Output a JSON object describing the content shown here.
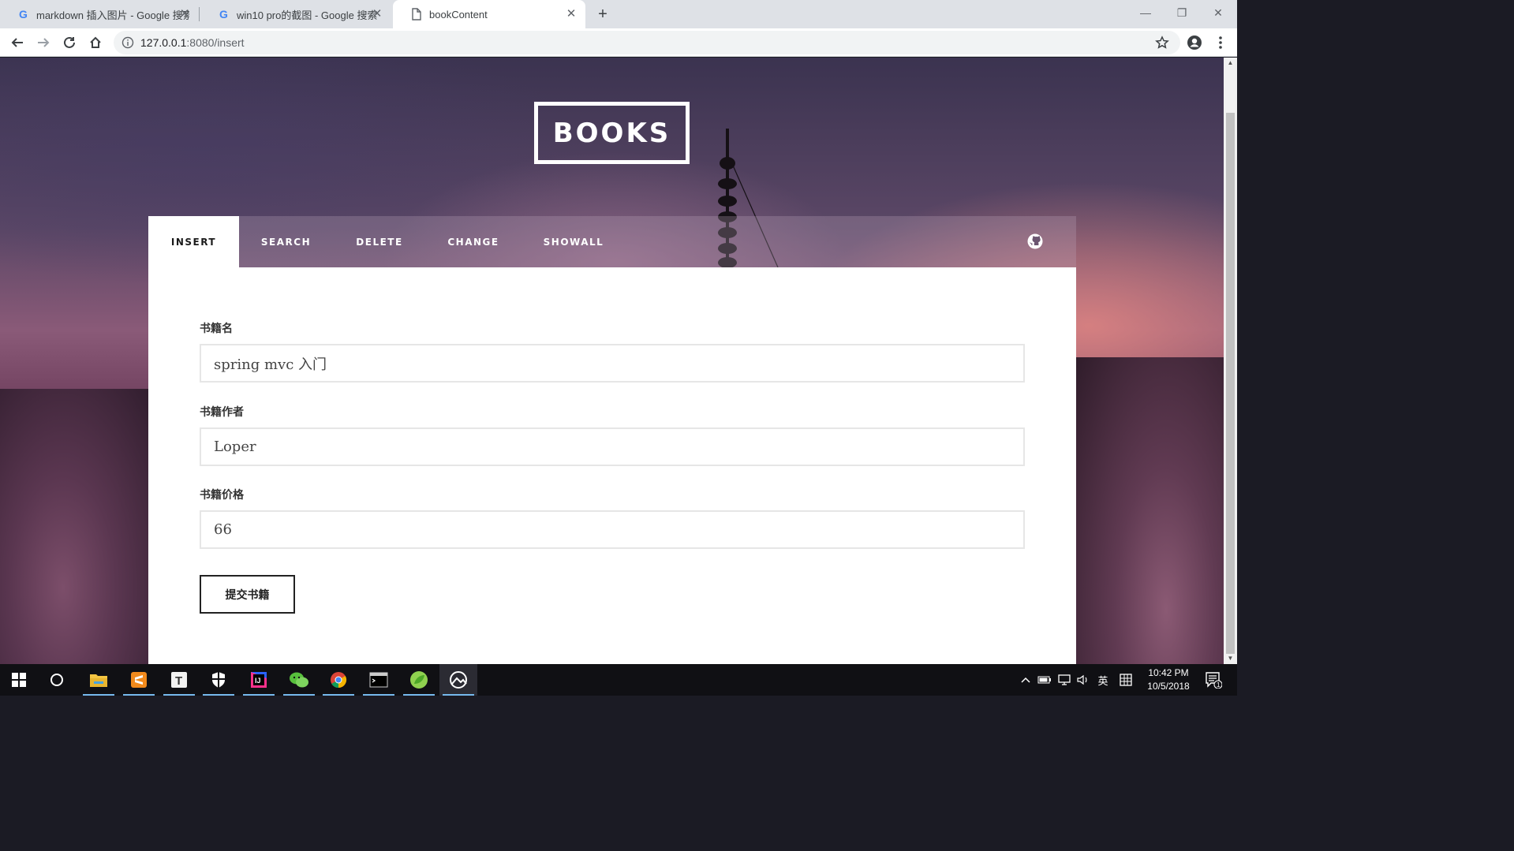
{
  "browser": {
    "tabs": [
      {
        "title": "markdown 插入图片 - Google 搜索",
        "favicon": "google-icon"
      },
      {
        "title": "win10 pro的截图 - Google 搜索",
        "favicon": "google-icon"
      },
      {
        "title": "bookContent",
        "favicon": "document-icon"
      }
    ],
    "url_host": "127.0.0.1",
    "url_rest": ":8080/insert"
  },
  "page": {
    "logo": "BOOKS",
    "nav": [
      {
        "label": "INSERT"
      },
      {
        "label": "SEARCH"
      },
      {
        "label": "DELETE"
      },
      {
        "label": "CHANGE"
      },
      {
        "label": "SHOWALL"
      }
    ],
    "active_nav": "INSERT",
    "form": {
      "name_label": "书籍名",
      "name_value": "spring mvc 入门",
      "author_label": "书籍作者",
      "author_value": "Loper",
      "price_label": "书籍价格",
      "price_value": "66",
      "submit_label": "提交书籍"
    }
  },
  "taskbar": {
    "apps": [
      "windows-start-icon",
      "cortana-icon",
      "file-explorer-icon",
      "sublime-text-icon",
      "typora-icon",
      "shield-icon",
      "intellij-icon",
      "wechat-icon",
      "chrome-icon",
      "terminal-icon",
      "leaf-app-icon",
      "photos-icon"
    ],
    "ime": "英",
    "time": "10:42 PM",
    "date": "10/5/2018",
    "notification_count": "1"
  },
  "colors": {
    "accent_active_tab": "#ffffff",
    "nav_text": "#ffffff",
    "panel_bg": "#ffffff",
    "input_border": "#e6e6e6",
    "button_border": "#222222"
  }
}
